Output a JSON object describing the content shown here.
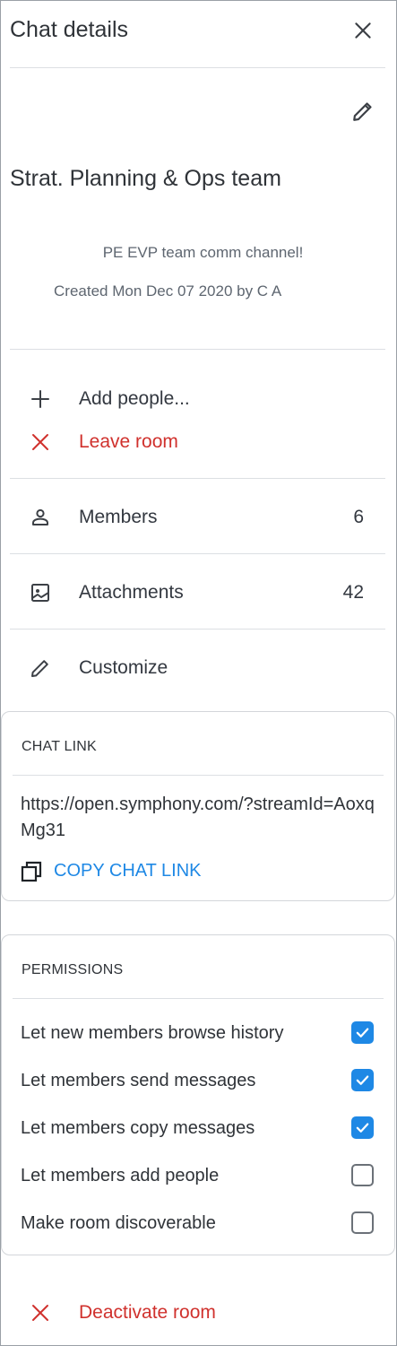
{
  "header": {
    "title": "Chat details"
  },
  "room": {
    "name": "Strat. Planning & Ops team",
    "description": "PE EVP team comm channel!",
    "created": "Created Mon Dec 07 2020 by C A"
  },
  "actions": {
    "add_people": "Add people...",
    "leave_room": "Leave room",
    "members": {
      "label": "Members",
      "count": "6"
    },
    "attachments": {
      "label": "Attachments",
      "count": "42"
    },
    "customize": "Customize"
  },
  "chat_link": {
    "heading": "CHAT LINK",
    "url": "https://open.symphony.com/?streamId=AoxqMg31",
    "copy_label": "COPY CHAT LINK"
  },
  "permissions": {
    "heading": "PERMISSIONS",
    "items": [
      {
        "label": "Let new members browse history",
        "checked": true
      },
      {
        "label": "Let members send messages",
        "checked": true
      },
      {
        "label": "Let members copy messages",
        "checked": true
      },
      {
        "label": "Let members add people",
        "checked": false
      },
      {
        "label": "Make room discoverable",
        "checked": false
      }
    ]
  },
  "footer": {
    "deactivate": "Deactivate room"
  },
  "colors": {
    "accent": "#1e88e5",
    "danger": "#d0312d",
    "text": "#2f3338",
    "muted": "#5e6670"
  },
  "icons": [
    "close-icon",
    "pencil-icon",
    "plus-icon",
    "x-icon",
    "person-icon",
    "image-icon",
    "pencil-icon",
    "copy-icon",
    "checkbox-checked-icon",
    "checkbox-empty-icon",
    "x-icon"
  ]
}
